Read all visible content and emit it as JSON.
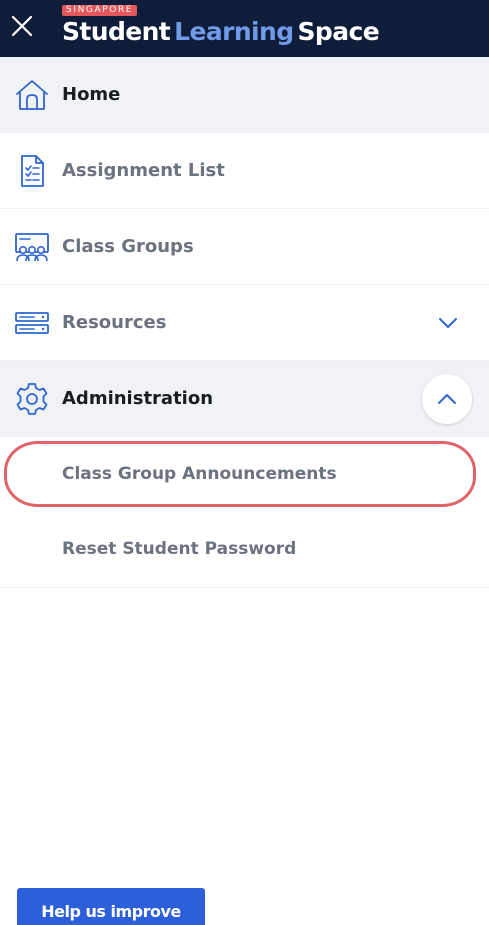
{
  "header": {
    "close_icon": "close-icon",
    "brand_badge": "SINGAPORE",
    "brand_word1": "Student",
    "brand_word2": "Learning",
    "brand_word3": "Space",
    "colors": {
      "background": "#0f1c3a",
      "badge": "#e4575a",
      "accent_word": "#6f9be8"
    }
  },
  "nav": {
    "items": [
      {
        "label": "Home",
        "icon": "home-icon"
      },
      {
        "label": "Assignment List",
        "icon": "assignment-list-icon"
      },
      {
        "label": "Class Groups",
        "icon": "class-groups-icon"
      },
      {
        "label": "Resources",
        "icon": "resources-icon",
        "chevron": "chevron-down-icon"
      },
      {
        "label": "Administration",
        "icon": "gear-icon",
        "chevron": "chevron-up-icon"
      }
    ],
    "sub_items": [
      {
        "label": "Class Group Announcements",
        "highlighted": true
      },
      {
        "label": "Reset Student Password"
      }
    ]
  },
  "footer": {
    "help_button": "Help us improve"
  },
  "colors": {
    "icon": "#2f66d0",
    "highlight": "#e06366",
    "help_button": "#2c5fd9"
  }
}
